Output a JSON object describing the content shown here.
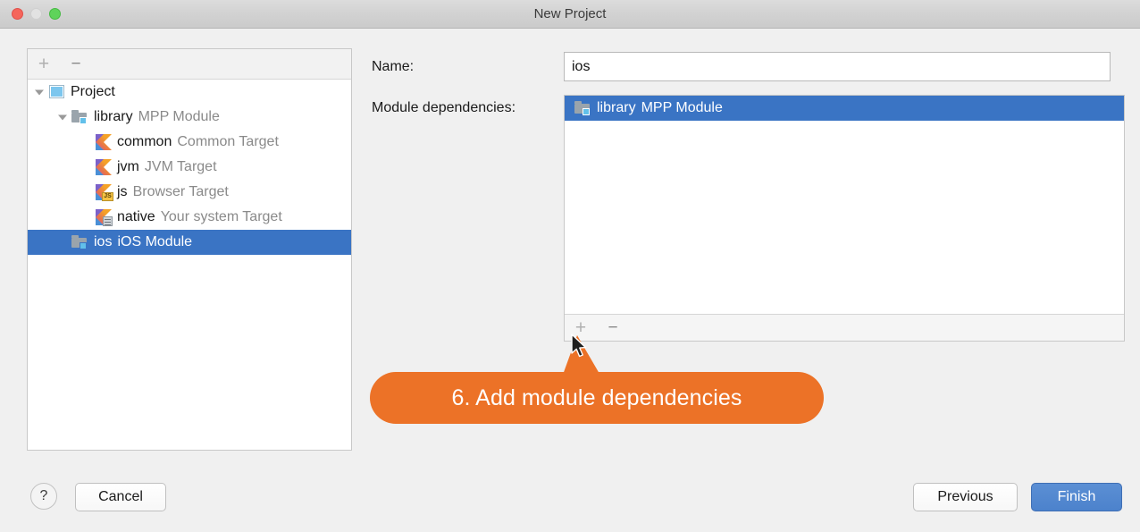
{
  "window": {
    "title": "New Project",
    "controls": {
      "close": "close-button",
      "minimize": "minimize-button",
      "zoom": "zoom-button"
    }
  },
  "tree_panel": {
    "toolbar": {
      "add_label": "+",
      "remove_label": "−"
    },
    "items": [
      {
        "indent": 0,
        "expanded": true,
        "icon": "project-icon",
        "name": "Project",
        "desc": "",
        "selected": false
      },
      {
        "indent": 1,
        "expanded": true,
        "icon": "module-icon",
        "name": "library",
        "desc": "MPP Module",
        "selected": false
      },
      {
        "indent": 2,
        "expanded": null,
        "icon": "kotlin-icon",
        "name": "common",
        "desc": "Common Target",
        "selected": false
      },
      {
        "indent": 2,
        "expanded": null,
        "icon": "kotlin-icon",
        "name": "jvm",
        "desc": "JVM Target",
        "selected": false
      },
      {
        "indent": 2,
        "expanded": null,
        "icon": "kotlin-js-icon",
        "name": "js",
        "desc": "Browser Target",
        "selected": false
      },
      {
        "indent": 2,
        "expanded": null,
        "icon": "kotlin-native-icon",
        "name": "native",
        "desc": "Your system Target",
        "selected": false
      },
      {
        "indent": 1,
        "expanded": null,
        "icon": "module-icon",
        "name": "ios",
        "desc": "iOS Module",
        "selected": true
      }
    ]
  },
  "form": {
    "name_label": "Name:",
    "name_value": "ios",
    "name_placeholder": "",
    "dependencies_label": "Module dependencies:",
    "dependencies": [
      {
        "icon": "module-icon",
        "name": "library",
        "desc": "MPP Module",
        "selected": true
      }
    ],
    "deps_toolbar": {
      "add_label": "+",
      "remove_label": "−"
    }
  },
  "callout": {
    "text": "6. Add module dependencies",
    "color": "#ec7227"
  },
  "footer": {
    "help_label": "?",
    "cancel_label": "Cancel",
    "previous_label": "Previous",
    "finish_label": "Finish"
  },
  "colors": {
    "selection_blue": "#3a74c4",
    "accent_orange": "#ec7227",
    "default_button_blue": "#4c82cc",
    "window_background": "#f0f0f0"
  }
}
